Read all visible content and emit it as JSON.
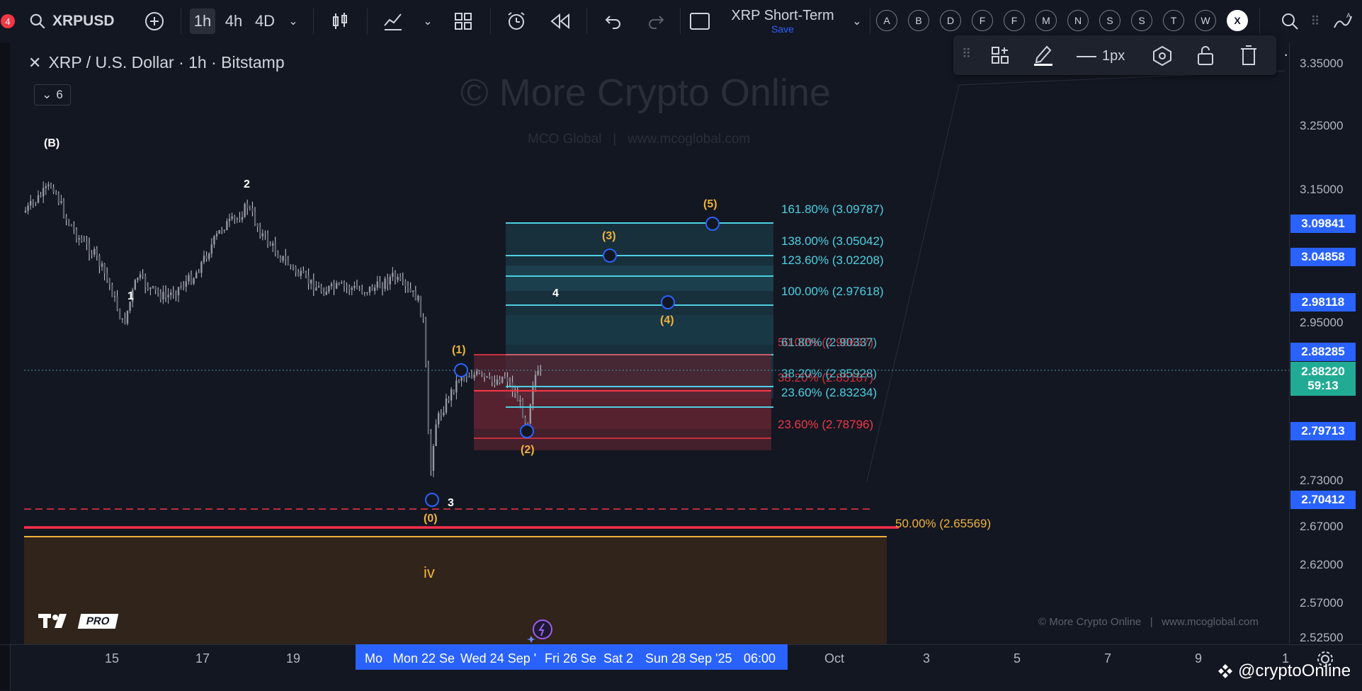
{
  "toolbar": {
    "symbol": "XRPUSD",
    "intervals": [
      "1h",
      "4h",
      "4D"
    ],
    "layout_name": "XRP Short-Term",
    "save_label": "Save",
    "letters": [
      "A",
      "B",
      "D",
      "F",
      "F",
      "M",
      "N",
      "S",
      "S",
      "T",
      "W",
      "X"
    ],
    "notif_count": "4"
  },
  "draw_toolbar": {
    "width_label": "1px"
  },
  "legend": {
    "title": "XRP / U.S. Dollar · 1h · Bitstamp",
    "collapse_count": "6"
  },
  "watermark": {
    "main": "© More Crypto Online",
    "sub": "MCO Global   |   www.mcoglobal.com"
  },
  "footer_credit": "© More Crypto Online   |   www.mcoglobal.com",
  "logo_text": "PRO",
  "social": "@cryptoOnline",
  "price_ticks": [
    "3.35000",
    "3.25000",
    "3.15000",
    "2.95000",
    "2.73000",
    "2.67000",
    "2.62000",
    "2.57000",
    "2.52500"
  ],
  "price_labels": [
    {
      "text": "3.09841",
      "color": "#2962ff"
    },
    {
      "text": "3.04858",
      "color": "#2962ff"
    },
    {
      "text": "2.98118",
      "color": "#2962ff"
    },
    {
      "text": "2.88285",
      "color": "#2962ff"
    },
    {
      "text": "2.88220",
      "sub": "59:13",
      "color": "#22ab94"
    },
    {
      "text": "2.79713",
      "color": "#2962ff"
    },
    {
      "text": "2.70412",
      "color": "#2962ff"
    }
  ],
  "date_ticks": [
    "15",
    "17",
    "19",
    "Oct",
    "3",
    "5",
    "7",
    "9",
    "1"
  ],
  "date_range": [
    "Mo",
    "Mon 22 Se",
    "Wed 24 Sep '",
    "Fri 26 Se",
    "Sat 2",
    "Sun 28 Sep '25",
    "06:00"
  ],
  "wave_labels": {
    "B": "(B)",
    "w2": "2",
    "w1": "1",
    "w3": "3",
    "w4": "4",
    "iv": "iv",
    "c0": "(0)",
    "c1": "(1)",
    "c2": "(2)",
    "c3": "(3)",
    "c4": "(4)",
    "c5": "(5)"
  },
  "fib_ext": [
    "161.80% (3.09787)",
    "138.00% (3.05042)",
    "123.60% (3.02208)",
    "100.00% (2.97618)",
    "61.80% (2.90337)",
    "38.20% (2.85928)",
    "23.60% (2.83234)"
  ],
  "fib_ret": [
    "50.00% (2.90637)",
    "38.20% (2.85187)",
    "23.60% (2.78796)"
  ],
  "fib_big": "50.00% (2.65569)",
  "colors": {
    "fib_blue": "#4dd0e1",
    "fib_red": "#f23645",
    "support_red": "#ff2e4c",
    "gold": "#f0b33a",
    "price_blue": "#2962ff"
  }
}
